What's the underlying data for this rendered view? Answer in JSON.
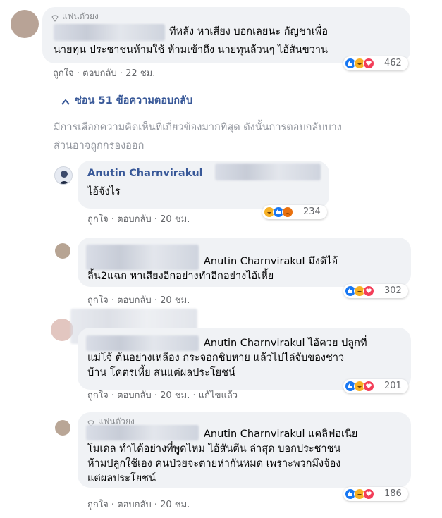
{
  "comment1": {
    "badge": "แฟนตัวยง",
    "lines": [
      "ทีหลัง หาเสียง บอกเลยนะ กัญชาเพื่อ",
      "นายทุน ประชาชนห้ามใช้ ห้ามเข้าถึง นายทุนล้วนๆ ไอ้สันขวาน"
    ],
    "actions": {
      "like": "ถูกใจ",
      "reply": "ตอบกลับ",
      "time": "22 ชม."
    },
    "reaction_count": "462"
  },
  "hide_replies": "ซ่อน 51 ข้อความตอบกลับ",
  "filter_note": [
    "มีการเลือกความคิดเห็นที่เกี่ยวข้องมากที่สุด ดังนั้นการตอบกลับบาง",
    "ส่วนอาจถูกกรองออก"
  ],
  "replies": [
    {
      "name": "Anutin Charnvirakul",
      "lines": [
        "ไอ้จังไร"
      ],
      "actions": {
        "like": "ถูกใจ",
        "reply": "ตอบกลับ",
        "time": "20 ชม."
      },
      "reaction_count": "234"
    },
    {
      "lines": [
        "Anutin Charnvirakul มึงดิไอ้",
        "ลิ้น2แฉก หาเสียงอีกอย่างทำอีกอย่างไอ้เหี้ย"
      ],
      "actions": {
        "like": "ถูกใจ",
        "reply": "ตอบกลับ",
        "time": "20 ชม."
      },
      "reaction_count": "302"
    },
    {
      "lines": [
        "Anutin Charnvirakul ไอ้ควย ปลูกที่",
        "แม่โจ้ ต้นอย่างเหลือง กระจอกชิบหาย แล้วไปไล่จับของชาว",
        "บ้าน โคตรเหี้ย สนแต่ผลประโยชน์"
      ],
      "actions": {
        "like": "ถูกใจ",
        "reply": "ตอบกลับ",
        "time": "20 ชม.",
        "edited": "แก้ไขแล้ว"
      },
      "reaction_count": "201"
    },
    {
      "badge": "แฟนตัวยง",
      "lines": [
        "Anutin Charnvirakul แคลิฟอเนีย",
        "โมเดล ทำได้อย่างที่พูดไหม ไอ้สันตีน ล่าสุด บอกประชาชน",
        "ห้ามปลูกใช้เอง คนป่วยจะตายห่ากันหมด เพราะพวกมึงจ้อง",
        "แต่ผลประโยชน์"
      ],
      "actions": {
        "like": "ถูกใจ",
        "reply": "ตอบกลับ",
        "time": "20 ชม."
      },
      "reaction_count": "186"
    }
  ],
  "separator": "·",
  "colors": {
    "link": "#385898",
    "meta": "#65676b",
    "bubble": "#f0f2f5",
    "like": "#1877f2",
    "haha": "#f7b125",
    "love": "#f33e58",
    "angry": "#e9710f"
  }
}
